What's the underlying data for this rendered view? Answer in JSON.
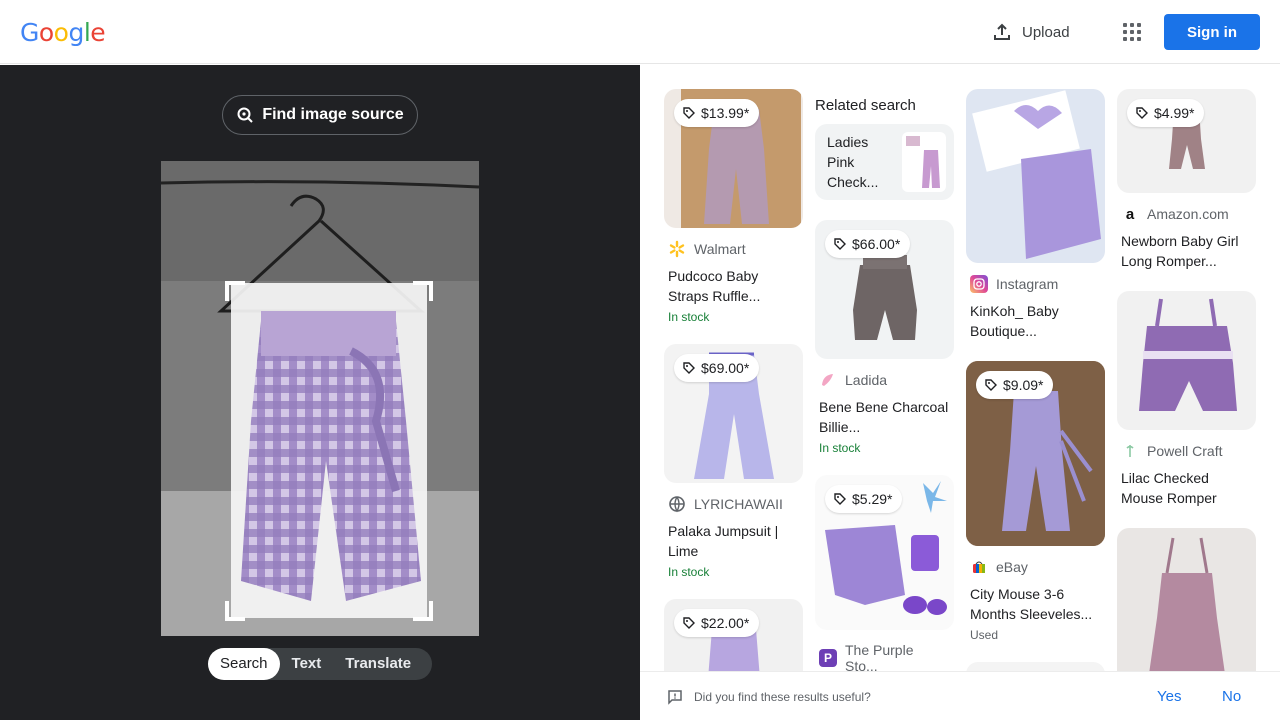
{
  "header": {
    "logo": "Google",
    "upload_label": "Upload",
    "signin_label": "Sign in"
  },
  "left": {
    "find_source_label": "Find image source",
    "modes": [
      "Search",
      "Text",
      "Translate"
    ],
    "active_mode": "Search"
  },
  "results": {
    "related_heading": "Related search",
    "related_item": "Ladies Pink Check...",
    "cards": [
      {
        "price": "$13.99*",
        "source": "Walmart",
        "title": "Pudcoco Baby Straps Ruffle...",
        "status": "In stock"
      },
      {
        "price": "$69.00*",
        "source": "LYRICHAWAII",
        "title": "Palaka Jumpsuit | Lime",
        "status": "In stock"
      },
      {
        "price": "$22.00*"
      },
      {
        "price": "$66.00*",
        "source": "Ladida",
        "title": "Bene Bene Charcoal Billie...",
        "status": "In stock"
      },
      {
        "price": "$5.29*",
        "source": "The Purple Sto..."
      },
      {
        "source": "Instagram",
        "title": "KinKoh_ Baby Boutique..."
      },
      {
        "price": "$9.09*",
        "source": "eBay",
        "title": "City Mouse 3-6 Months Sleeveles...",
        "status": "Used"
      },
      {
        "price": "$4.99*",
        "source": "Amazon.com",
        "title": "Newborn Baby Girl Long Romper..."
      },
      {
        "source": "Powell Craft",
        "title": "Lilac Checked Mouse Romper"
      }
    ]
  },
  "feedback": {
    "question": "Did you find these results useful?",
    "yes": "Yes",
    "no": "No"
  },
  "colors": {
    "accent": "#1a73e8",
    "dark_panel": "#202124",
    "in_stock": "#188038"
  }
}
